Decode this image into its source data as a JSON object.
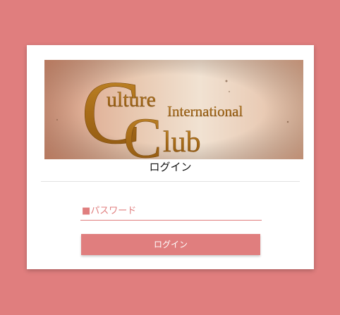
{
  "logo": {
    "big_c": "C",
    "word_ulture": "ulture",
    "word_international": "International",
    "big_c2": "C",
    "word_lub": "lub"
  },
  "login_title": "ログイン",
  "password": {
    "value": "",
    "placeholder": "■パスワード"
  },
  "login_button": "ログイン",
  "colors": {
    "background": "#e07e7e",
    "accent": "#e07e7e",
    "card": "#ffffff"
  }
}
